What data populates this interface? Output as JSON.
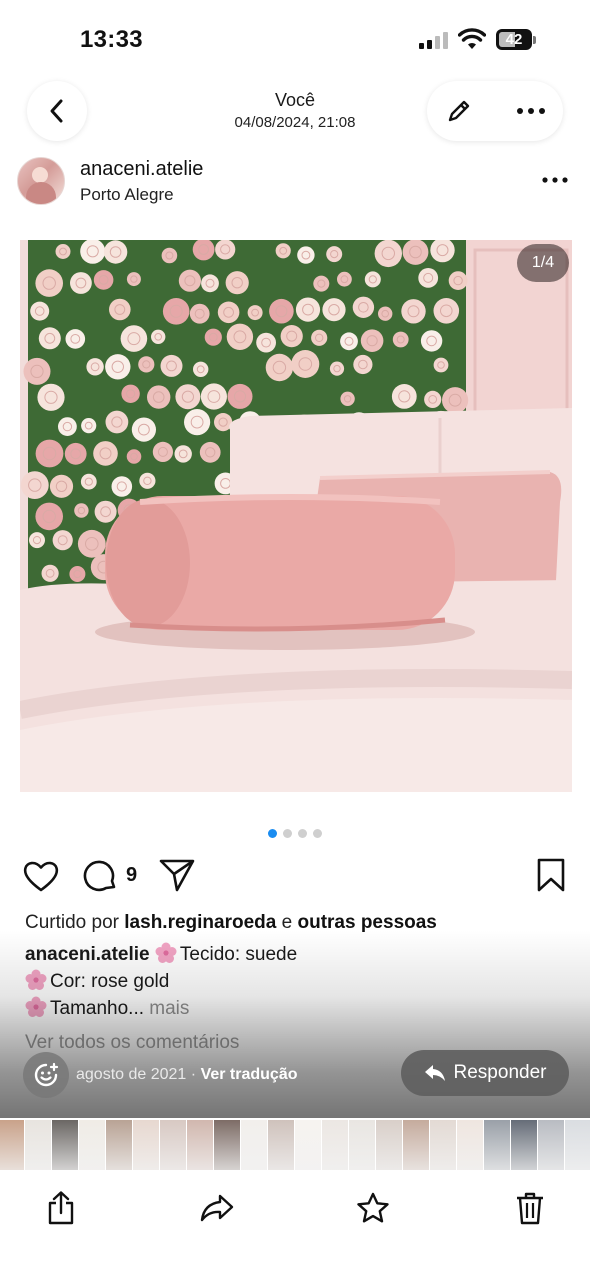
{
  "status_bar": {
    "time": "13:33",
    "battery": "42"
  },
  "nav": {
    "title": "Você",
    "subtitle": "04/08/2024, 21:08",
    "back_icon": "chevron-left-icon",
    "edit_icon": "pencil-icon",
    "more_icon": "ellipsis-icon"
  },
  "post": {
    "username": "anaceni.atelie",
    "location": "Porto Alegre",
    "image_counter": "1/4",
    "carousel": {
      "total": 4,
      "active": 1
    },
    "comment_count": "9",
    "likes": {
      "prefix": "Curtido por",
      "user": "lash.reginaroeda",
      "joiner": "e",
      "others": "outras pessoas"
    },
    "caption": {
      "author": "anaceni.atelie",
      "line1": "Tecido: suede",
      "line2": "Cor: rose gold",
      "line3": "Tamanho...",
      "more": "mais"
    },
    "view_comments": "Ver todos os comentários",
    "date": "agosto de 2021",
    "separator": "·",
    "translate": "Ver tradução",
    "reply_label": "Responder"
  },
  "toolbar": {
    "share_icon": "share-icon",
    "forward_icon": "forward-icon",
    "favorite_icon": "star-icon",
    "delete_icon": "trash-icon"
  },
  "colors": {
    "accent_dot": "#1a8cf0",
    "pink": "#eab0ae"
  }
}
